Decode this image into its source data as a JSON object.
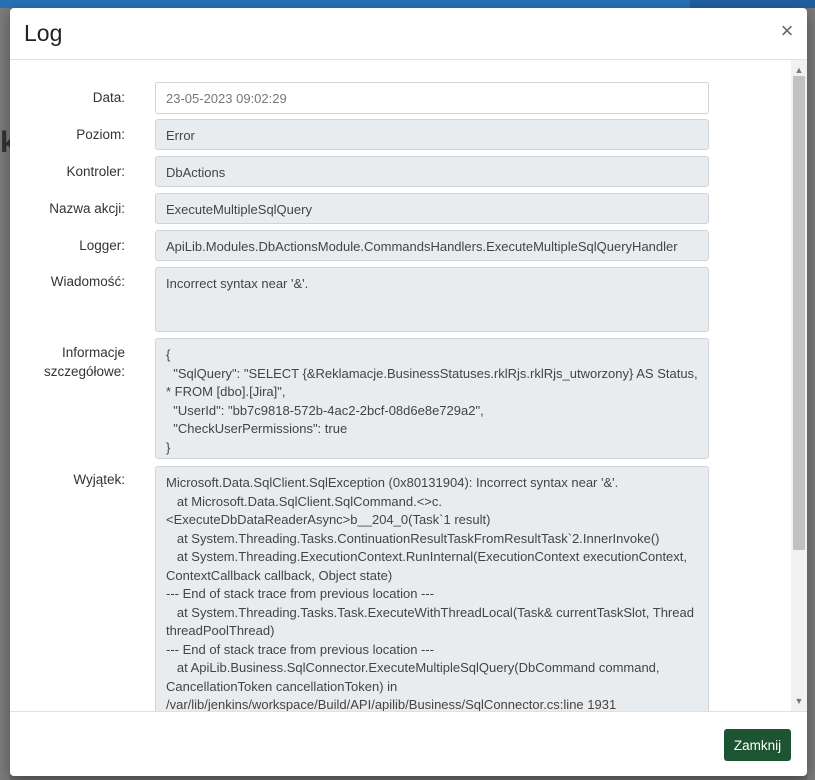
{
  "modal": {
    "title": "Log",
    "close_icon_glyph": "×",
    "close_button_label": "Zamknij"
  },
  "fields": {
    "data_label": "Data:",
    "data_value": "23-05-2023 09:02:29",
    "level_label": "Poziom:",
    "level_value": "Error",
    "controller_label": "Kontroler:",
    "controller_value": "DbActions",
    "action_label": "Nazwa akcji:",
    "action_value": "ExecuteMultipleSqlQuery",
    "logger_label": "Logger:",
    "logger_value": "ApiLib.Modules.DbActionsModule.CommandsHandlers.ExecuteMultipleSqlQueryHandler",
    "message_label": "Wiadomość:",
    "message_value": "Incorrect syntax near '&'.",
    "details_label": "Informacje szczegółowe:",
    "details_value": "{\n  \"SqlQuery\": \"SELECT {&Reklamacje.BusinessStatuses.rklRjs.rklRjs_utworzony} AS Status, * FROM [dbo].[Jira]\",\n  \"UserId\": \"bb7c9818-572b-4ac2-2bcf-08d6e8e729a2\",\n  \"CheckUserPermissions\": true\n}",
    "exception_label": "Wyjątek:",
    "exception_value": "Microsoft.Data.SqlClient.SqlException (0x80131904): Incorrect syntax near '&'.\n   at Microsoft.Data.SqlClient.SqlCommand.<>c.<ExecuteDbDataReaderAsync>b__204_0(Task`1 result)\n   at System.Threading.Tasks.ContinuationResultTaskFromResultTask`2.InnerInvoke()\n   at System.Threading.ExecutionContext.RunInternal(ExecutionContext executionContext, ContextCallback callback, Object state)\n--- End of stack trace from previous location ---\n   at System.Threading.Tasks.Task.ExecuteWithThreadLocal(Task& currentTaskSlot, Thread threadPoolThread)\n--- End of stack trace from previous location ---\n   at ApiLib.Business.SqlConnector.ExecuteMultipleSqlQuery(DbCommand command, CancellationToken cancellationToken) in /var/lib/jenkins/workspace/Build/API/apilib/Business/SqlConnector.cs:line 1931\n   at ApiLib.Business.SqlConnector.ExecuteMultipleSqlQuery(String query..."
  },
  "scrollbar": {
    "up_glyph": "▲",
    "down_glyph": "▼"
  },
  "colors": {
    "primary_button": "#1d5532",
    "readonly_field": "#e9ecef",
    "background_overlay": "#6b6b6b"
  }
}
